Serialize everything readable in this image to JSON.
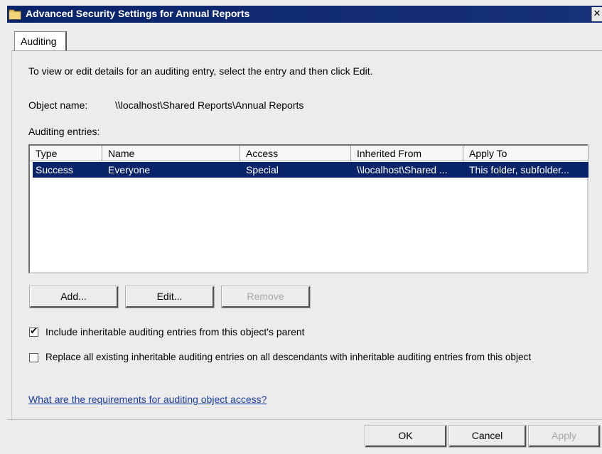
{
  "window": {
    "title": "Advanced Security Settings for Annual Reports",
    "close_glyph": "✕"
  },
  "tabs": [
    {
      "label": "Auditing",
      "selected": true
    }
  ],
  "instructions": "To view or edit details for an auditing entry, select the entry and then click Edit.",
  "object": {
    "label": "Object name:",
    "value": "\\\\localhost\\Shared Reports\\Annual Reports"
  },
  "entries": {
    "label": "Auditing entries:",
    "columns": [
      "Type",
      "Name",
      "Access",
      "Inherited From",
      "Apply To"
    ],
    "rows": [
      {
        "type": "Success",
        "name": "Everyone",
        "access": "Special",
        "inherited_from": "\\\\localhost\\Shared ...",
        "apply_to": "This folder, subfolder...",
        "selected": true
      }
    ]
  },
  "buttons": {
    "add": "Add...",
    "edit": "Edit...",
    "remove": "Remove",
    "ok": "OK",
    "cancel": "Cancel",
    "apply": "Apply"
  },
  "options": {
    "include_inheritable": {
      "label": "Include inheritable auditing entries from this object's parent",
      "checked": true
    },
    "replace_all": {
      "label": "Replace all existing inheritable auditing entries on all descendants with inheritable auditing entries from this object",
      "checked": false
    }
  },
  "help_link": "What are the requirements for auditing object access?",
  "icons": {
    "title": "folder-icon",
    "close": "close-icon",
    "check": "checkmark-icon"
  },
  "colors": {
    "titlebar": "#0a246a",
    "selection": "#0a246a",
    "link": "#1b3fa0",
    "dialog_bg": "#ececec"
  }
}
